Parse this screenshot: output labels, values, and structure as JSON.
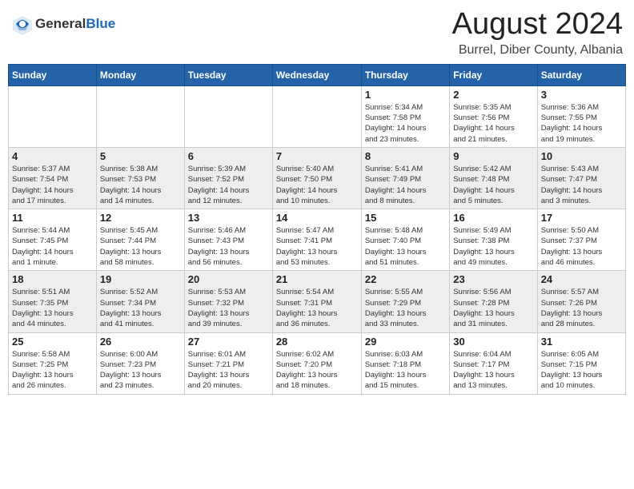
{
  "header": {
    "logo_general": "General",
    "logo_blue": "Blue",
    "title": "August 2024",
    "subtitle": "Burrel, Diber County, Albania"
  },
  "weekdays": [
    "Sunday",
    "Monday",
    "Tuesday",
    "Wednesday",
    "Thursday",
    "Friday",
    "Saturday"
  ],
  "weeks": [
    [
      {
        "day": "",
        "info": ""
      },
      {
        "day": "",
        "info": ""
      },
      {
        "day": "",
        "info": ""
      },
      {
        "day": "",
        "info": ""
      },
      {
        "day": "1",
        "info": "Sunrise: 5:34 AM\nSunset: 7:58 PM\nDaylight: 14 hours\nand 23 minutes."
      },
      {
        "day": "2",
        "info": "Sunrise: 5:35 AM\nSunset: 7:56 PM\nDaylight: 14 hours\nand 21 minutes."
      },
      {
        "day": "3",
        "info": "Sunrise: 5:36 AM\nSunset: 7:55 PM\nDaylight: 14 hours\nand 19 minutes."
      }
    ],
    [
      {
        "day": "4",
        "info": "Sunrise: 5:37 AM\nSunset: 7:54 PM\nDaylight: 14 hours\nand 17 minutes."
      },
      {
        "day": "5",
        "info": "Sunrise: 5:38 AM\nSunset: 7:53 PM\nDaylight: 14 hours\nand 14 minutes."
      },
      {
        "day": "6",
        "info": "Sunrise: 5:39 AM\nSunset: 7:52 PM\nDaylight: 14 hours\nand 12 minutes."
      },
      {
        "day": "7",
        "info": "Sunrise: 5:40 AM\nSunset: 7:50 PM\nDaylight: 14 hours\nand 10 minutes."
      },
      {
        "day": "8",
        "info": "Sunrise: 5:41 AM\nSunset: 7:49 PM\nDaylight: 14 hours\nand 8 minutes."
      },
      {
        "day": "9",
        "info": "Sunrise: 5:42 AM\nSunset: 7:48 PM\nDaylight: 14 hours\nand 5 minutes."
      },
      {
        "day": "10",
        "info": "Sunrise: 5:43 AM\nSunset: 7:47 PM\nDaylight: 14 hours\nand 3 minutes."
      }
    ],
    [
      {
        "day": "11",
        "info": "Sunrise: 5:44 AM\nSunset: 7:45 PM\nDaylight: 14 hours\nand 1 minute."
      },
      {
        "day": "12",
        "info": "Sunrise: 5:45 AM\nSunset: 7:44 PM\nDaylight: 13 hours\nand 58 minutes."
      },
      {
        "day": "13",
        "info": "Sunrise: 5:46 AM\nSunset: 7:43 PM\nDaylight: 13 hours\nand 56 minutes."
      },
      {
        "day": "14",
        "info": "Sunrise: 5:47 AM\nSunset: 7:41 PM\nDaylight: 13 hours\nand 53 minutes."
      },
      {
        "day": "15",
        "info": "Sunrise: 5:48 AM\nSunset: 7:40 PM\nDaylight: 13 hours\nand 51 minutes."
      },
      {
        "day": "16",
        "info": "Sunrise: 5:49 AM\nSunset: 7:38 PM\nDaylight: 13 hours\nand 49 minutes."
      },
      {
        "day": "17",
        "info": "Sunrise: 5:50 AM\nSunset: 7:37 PM\nDaylight: 13 hours\nand 46 minutes."
      }
    ],
    [
      {
        "day": "18",
        "info": "Sunrise: 5:51 AM\nSunset: 7:35 PM\nDaylight: 13 hours\nand 44 minutes."
      },
      {
        "day": "19",
        "info": "Sunrise: 5:52 AM\nSunset: 7:34 PM\nDaylight: 13 hours\nand 41 minutes."
      },
      {
        "day": "20",
        "info": "Sunrise: 5:53 AM\nSunset: 7:32 PM\nDaylight: 13 hours\nand 39 minutes."
      },
      {
        "day": "21",
        "info": "Sunrise: 5:54 AM\nSunset: 7:31 PM\nDaylight: 13 hours\nand 36 minutes."
      },
      {
        "day": "22",
        "info": "Sunrise: 5:55 AM\nSunset: 7:29 PM\nDaylight: 13 hours\nand 33 minutes."
      },
      {
        "day": "23",
        "info": "Sunrise: 5:56 AM\nSunset: 7:28 PM\nDaylight: 13 hours\nand 31 minutes."
      },
      {
        "day": "24",
        "info": "Sunrise: 5:57 AM\nSunset: 7:26 PM\nDaylight: 13 hours\nand 28 minutes."
      }
    ],
    [
      {
        "day": "25",
        "info": "Sunrise: 5:58 AM\nSunset: 7:25 PM\nDaylight: 13 hours\nand 26 minutes."
      },
      {
        "day": "26",
        "info": "Sunrise: 6:00 AM\nSunset: 7:23 PM\nDaylight: 13 hours\nand 23 minutes."
      },
      {
        "day": "27",
        "info": "Sunrise: 6:01 AM\nSunset: 7:21 PM\nDaylight: 13 hours\nand 20 minutes."
      },
      {
        "day": "28",
        "info": "Sunrise: 6:02 AM\nSunset: 7:20 PM\nDaylight: 13 hours\nand 18 minutes."
      },
      {
        "day": "29",
        "info": "Sunrise: 6:03 AM\nSunset: 7:18 PM\nDaylight: 13 hours\nand 15 minutes."
      },
      {
        "day": "30",
        "info": "Sunrise: 6:04 AM\nSunset: 7:17 PM\nDaylight: 13 hours\nand 13 minutes."
      },
      {
        "day": "31",
        "info": "Sunrise: 6:05 AM\nSunset: 7:15 PM\nDaylight: 13 hours\nand 10 minutes."
      }
    ]
  ]
}
